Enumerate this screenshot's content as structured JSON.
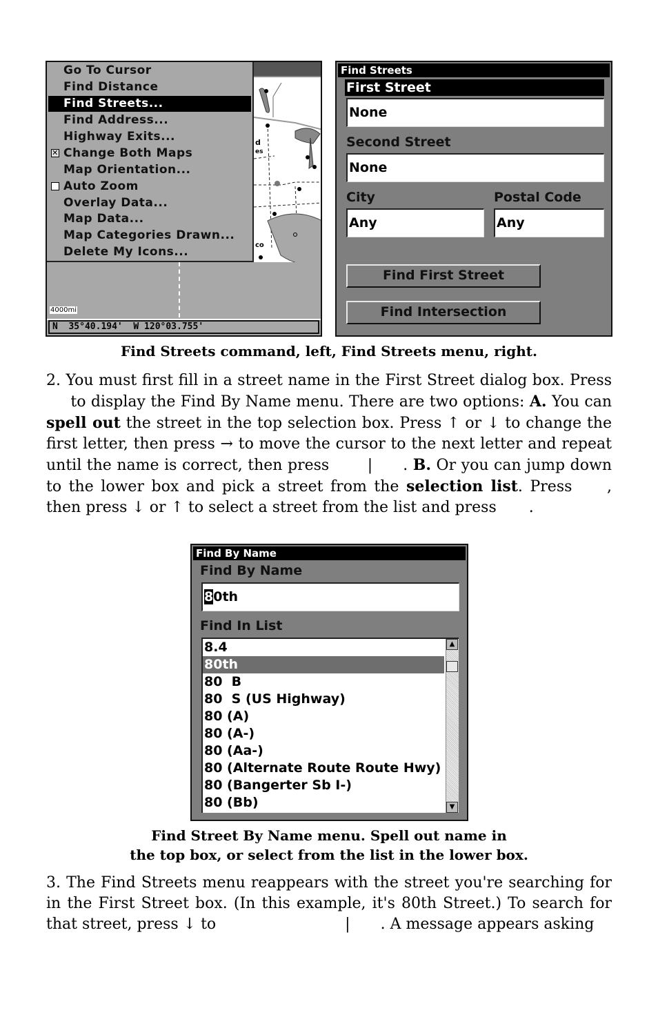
{
  "screen_left": {
    "menu_items": [
      {
        "label": "Go To Cursor",
        "selected": false,
        "checkbox": null
      },
      {
        "label": "Find Distance",
        "selected": false,
        "checkbox": null
      },
      {
        "label": "Find Streets...",
        "selected": true,
        "checkbox": null
      },
      {
        "label": "Find Address...",
        "selected": false,
        "checkbox": null
      },
      {
        "label": "Highway Exits...",
        "selected": false,
        "checkbox": null
      },
      {
        "label": "Change Both Maps",
        "selected": false,
        "checkbox": "checked"
      },
      {
        "label": "Map Orientation...",
        "selected": false,
        "checkbox": null
      },
      {
        "label": "Auto Zoom",
        "selected": false,
        "checkbox": "unchecked"
      },
      {
        "label": "Overlay Data...",
        "selected": false,
        "checkbox": null
      },
      {
        "label": "Map Data...",
        "selected": false,
        "checkbox": null
      },
      {
        "label": "Map Categories Drawn...",
        "selected": false,
        "checkbox": null
      },
      {
        "label": "Delete My Icons...",
        "selected": false,
        "checkbox": null
      }
    ],
    "check_mark": "✕",
    "map_labels": {
      "fragment_1": "d",
      "fragment_2": "es",
      "fragment_3": "co"
    },
    "scale": "4000mi",
    "coordinates": "N  35°40.194'  W 120°03.755'"
  },
  "screen_right": {
    "title": "Find Streets",
    "first_street_label": "First Street",
    "first_street_value": "None",
    "second_street_label": "Second Street",
    "second_street_value": "None",
    "city_label": "City",
    "city_value": "Any",
    "postal_label": "Postal Code",
    "postal_value": "Any",
    "find_first_button": "Find First Street",
    "find_intersection_button": "Find Intersection"
  },
  "caption_1": "Find Streets command, left, Find Streets menu, right.",
  "para_2": {
    "s1": "2. You must first fill in a street name in the First Street dialog box. Press ",
    "s2": " to display the Find By Name menu. There are two options: ",
    "a_label": "A.",
    "s3": " You can ",
    "spell_out": "spell out",
    "s4": " the street in the top selection box. Press ↑ or ↓ to change the first letter, then press → to move the cursor to the next letter and repeat until the name is correct, then press ",
    "pipe": "|",
    "s5": ". ",
    "b_label": "B.",
    "s6": " Or you can jump down to the lower box and pick a street from the ",
    "selection_list": "selection list",
    "s7": ". Press ",
    "s8": ", then press ↓ or ↑ to select a street from the list and press ",
    "s9": "."
  },
  "screen_bottom": {
    "title": "Find By Name",
    "name_label": "Find By Name",
    "input_cursor_char": "8",
    "input_rest": "0th",
    "list_label": "Find In List",
    "list_items": [
      {
        "label": "8.4",
        "selected": false
      },
      {
        "label": "80th",
        "selected": true
      },
      {
        "label": "80  B",
        "selected": false
      },
      {
        "label": "80  S (US Highway)",
        "selected": false
      },
      {
        "label": "80 (A)",
        "selected": false
      },
      {
        "label": "80 (A-)",
        "selected": false
      },
      {
        "label": "80 (Aa-)",
        "selected": false
      },
      {
        "label": "80 (Alternate Route Route Hwy)",
        "selected": false
      },
      {
        "label": "80 (Bangerter Sb I-)",
        "selected": false
      },
      {
        "label": "80 (Bb)",
        "selected": false
      }
    ],
    "scroll_up": "▲",
    "scroll_down": "▼"
  },
  "caption_2": {
    "line1": "Find Street By Name menu. Spell out name in",
    "line2": "the top box, or select from the list in the lower box."
  },
  "para_3": {
    "s1": "3. The Find Streets menu reappears with the street you're searching for in the First Street box. (In this example, it's 80th Street.) To search for that street, press ↓ to ",
    "pipe": "|",
    "s2": ". A message appears asking"
  }
}
